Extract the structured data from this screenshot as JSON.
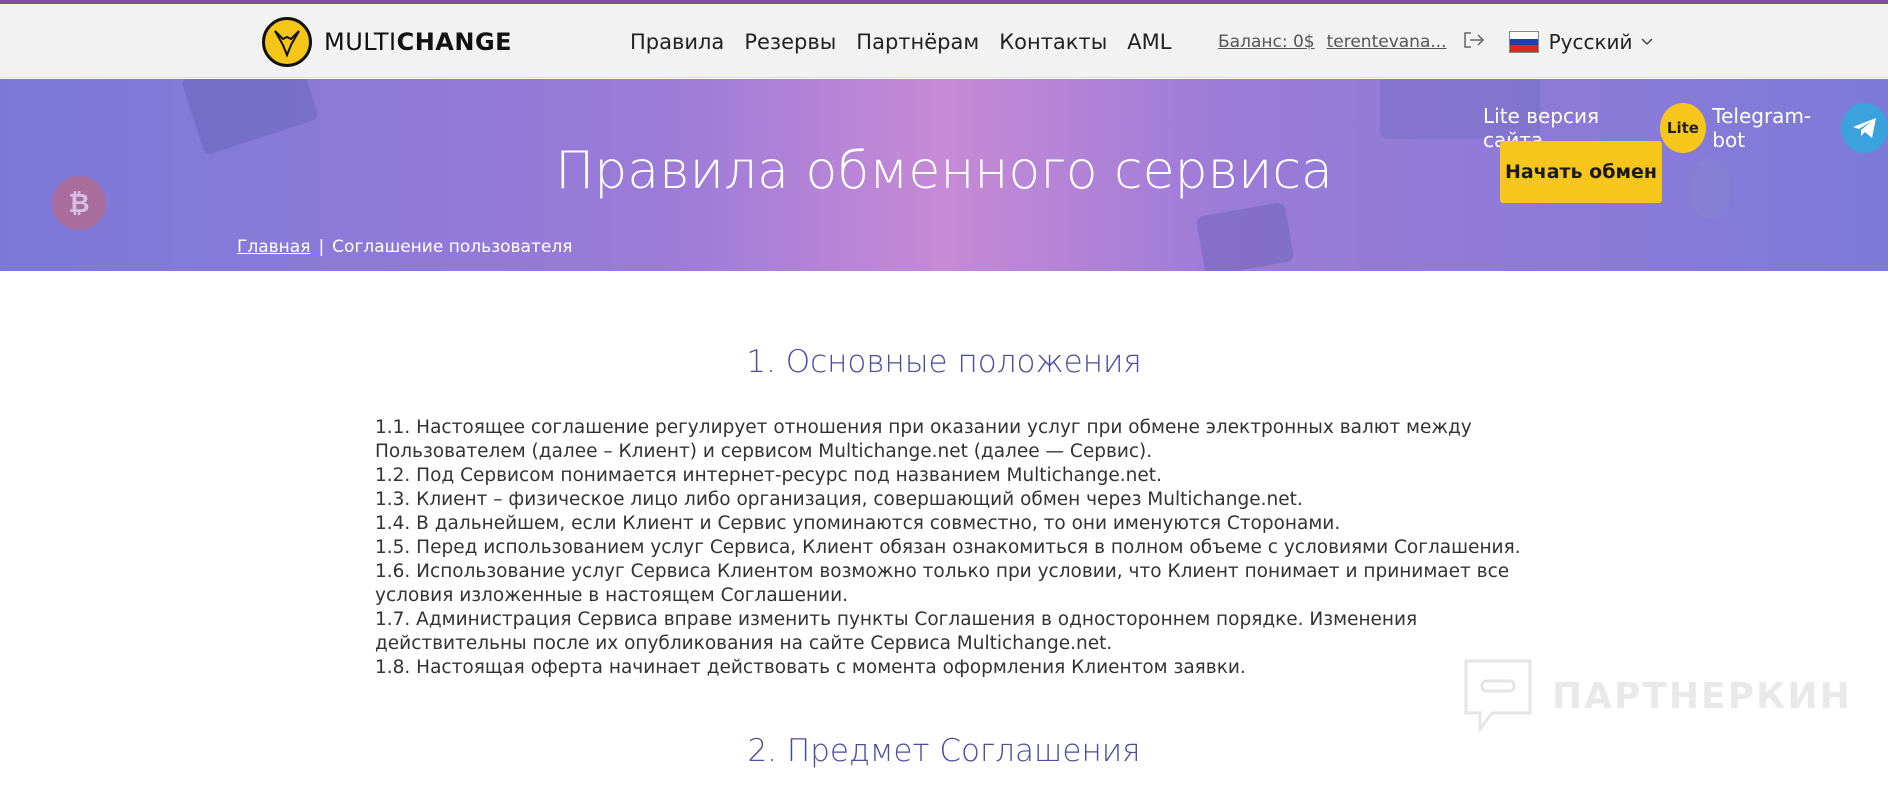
{
  "header": {
    "logo_text_light": "MULTI",
    "logo_text_bold": "CHANGE",
    "nav": [
      "Правила",
      "Резервы",
      "Партнёрам",
      "Контакты",
      "AML"
    ],
    "balance": "Баланс: 0$",
    "user": "terentevana...",
    "language": "Русский"
  },
  "hero": {
    "title": "Правила обменного сервиса",
    "breadcrumb_home": "Главная",
    "breadcrumb_sep": "|",
    "breadcrumb_current": "Соглашение пользователя",
    "lite_label": "Lite версия сайта",
    "lite_badge": "Lite",
    "telegram_label": "Telegram-bot",
    "start_button": "Начать обмен"
  },
  "section1": {
    "num": "1.",
    "title": "Основные положения",
    "items": [
      "1.1. Настоящее соглашение регулирует отношения при оказании услуг при обмене электронных валют между Пользователем (далее – Клиент) и сервисом Multichange.net (далее — Сервис).",
      "1.2. Под Сервисом понимается интернет-ресурс под названием Multichange.net.",
      "1.3. Клиент – физическое лицо либо организация, совершающий обмен через Multichange.net.",
      "1.4. В дальнейшем, если Клиент и Сервис упоминаются совместно, то они именуются Сторонами.",
      "1.5. Перед использованием услуг Сервиса, Клиент обязан ознакомиться в полном объеме с условиями Соглашения.",
      "1.6. Использование услуг Сервиса Клиентом возможно только при условии, что Клиент понимает и принимает все условия изложенные в настоящем Соглашении.",
      "1.7. Администрация Сервиса вправе изменить пункты Соглашения в одностороннем порядке. Изменения действительны после их опубликования на сайте Сервиса Multichange.net.",
      "1.8. Настоящая оферта начинает действовать с момента оформления Клиентом заявки."
    ]
  },
  "section2": {
    "title": "2. Предмет Соглашения"
  },
  "watermark": "ПАРТНЕРКИН",
  "colors": {
    "accent_yellow": "#f7c61c",
    "heading_blue": "#4b4ba0",
    "telegram": "#3aa3dd"
  }
}
